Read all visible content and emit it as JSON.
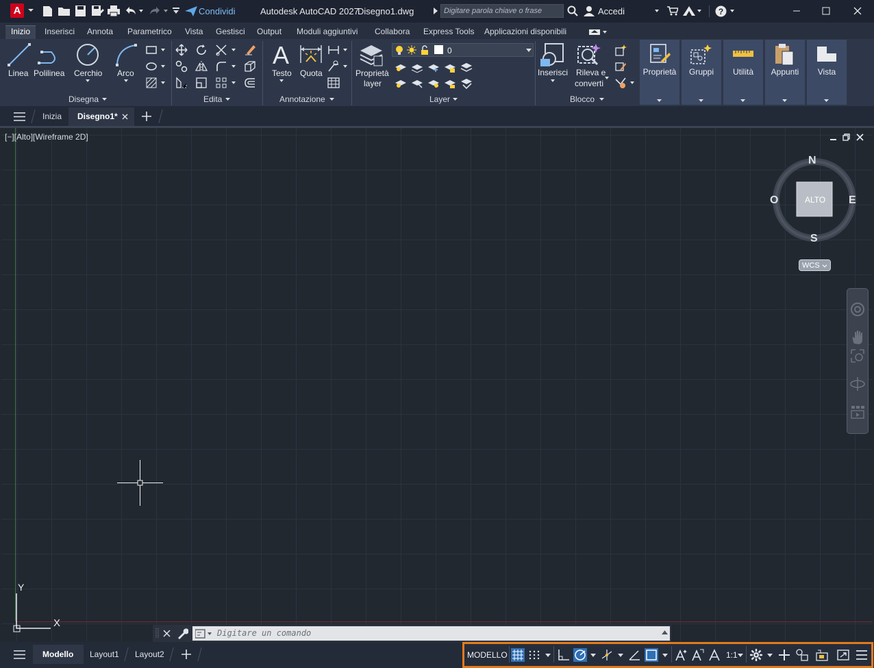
{
  "title_bar": {
    "app_logo": "A",
    "share_label": "Condividi",
    "app_title": "Autodesk AutoCAD 2027",
    "file_name": "Disegno1.dwg",
    "search_placeholder": "Digitare parola chiave o frase",
    "signin_label": "Accedi"
  },
  "ribbon_tabs": [
    "Inizio",
    "Inserisci",
    "Annota",
    "Parametrico",
    "Vista",
    "Gestisci",
    "Output",
    "Moduli aggiuntivi",
    "Collabora",
    "Express Tools",
    "Applicazioni disponibili"
  ],
  "ribbon": {
    "draw": {
      "title": "Disegna",
      "linea": "Linea",
      "polilinea": "Polilinea",
      "cerchio": "Cerchio",
      "arco": "Arco"
    },
    "edit": {
      "title": "Edita"
    },
    "annotation": {
      "title": "Annotazione",
      "testo": "Testo",
      "quota": "Quota"
    },
    "layer": {
      "title": "Layer",
      "props_line1": "Proprietà",
      "props_line2": "layer",
      "current_layer": "0"
    },
    "block": {
      "title": "Blocco",
      "inserisci": "Inserisci",
      "rileva_line1": "Rileva e",
      "rileva_line2": "converti"
    },
    "big_panels": [
      "Proprietà",
      "Gruppi",
      "Utilità",
      "Appunti",
      "Vista"
    ]
  },
  "file_tabs": {
    "home": "Inizia",
    "active": "Disegno1*"
  },
  "viewport": {
    "label": "[−][Alto][Wireframe 2D]",
    "compass": {
      "n": "N",
      "s": "S",
      "e": "E",
      "w": "O",
      "face": "ALTO"
    },
    "wcs": "WCS",
    "ucs_x": "X",
    "ucs_y": "Y"
  },
  "command_line": {
    "placeholder": "Digitare un comando"
  },
  "layout_tabs": [
    "Modello",
    "Layout1",
    "Layout2"
  ],
  "status_bar": {
    "model_label": "MODELLO",
    "scale": "1:1"
  },
  "colors": {
    "accent_orange": "#e47a1c",
    "active_blue": "#2f6fb5",
    "logo_red": "#d0021b"
  }
}
